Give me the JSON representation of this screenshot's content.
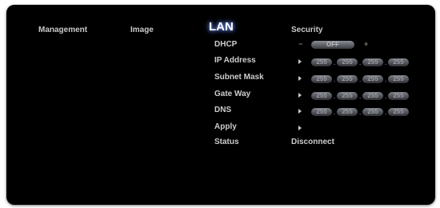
{
  "tabs": {
    "management": "Management",
    "image": "Image",
    "lan": "LAN",
    "security": "Security"
  },
  "dhcp": {
    "label": "DHCP",
    "value": "OFF",
    "minus": "−",
    "plus": "+"
  },
  "ip_address": {
    "label": "IP Address",
    "octets": [
      "255",
      "255",
      "255",
      "255"
    ]
  },
  "subnet_mask": {
    "label": "Subnet Mask",
    "octets": [
      "255",
      "255",
      "255",
      "255"
    ]
  },
  "gateway": {
    "label": "Gate Way",
    "octets": [
      "255",
      "255",
      "255",
      "255"
    ]
  },
  "dns": {
    "label": "DNS",
    "octets": [
      "255",
      "255",
      "255",
      "255"
    ]
  },
  "apply": {
    "label": "Apply"
  },
  "status": {
    "label": "Status",
    "value": "Disconnect"
  },
  "colors": {
    "background": "#000000",
    "text": "#cdcdcd",
    "active_glow": "#7fa6ff",
    "field": "#5a5d63"
  }
}
